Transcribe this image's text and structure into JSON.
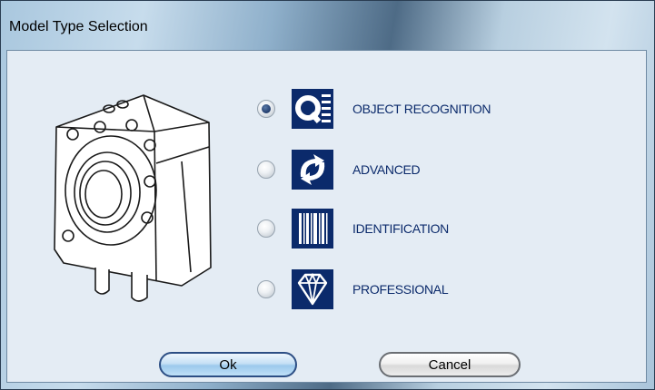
{
  "window": {
    "title": "Model Type Selection"
  },
  "options": [
    {
      "label": "OBJECT RECOGNITION",
      "icon": "q-recognition-icon",
      "selected": true
    },
    {
      "label": "ADVANCED",
      "icon": "advanced-arrows-icon",
      "selected": false
    },
    {
      "label": "IDENTIFICATION",
      "icon": "barcode-icon",
      "selected": false
    },
    {
      "label": "PROFESSIONAL",
      "icon": "diamond-icon",
      "selected": false
    }
  ],
  "buttons": {
    "ok_label": "Ok",
    "cancel_label": "Cancel"
  },
  "colors": {
    "accent": "#0b2a6b",
    "label_text": "#0b2a6b",
    "dialog_bg": "#e4ecf4"
  }
}
